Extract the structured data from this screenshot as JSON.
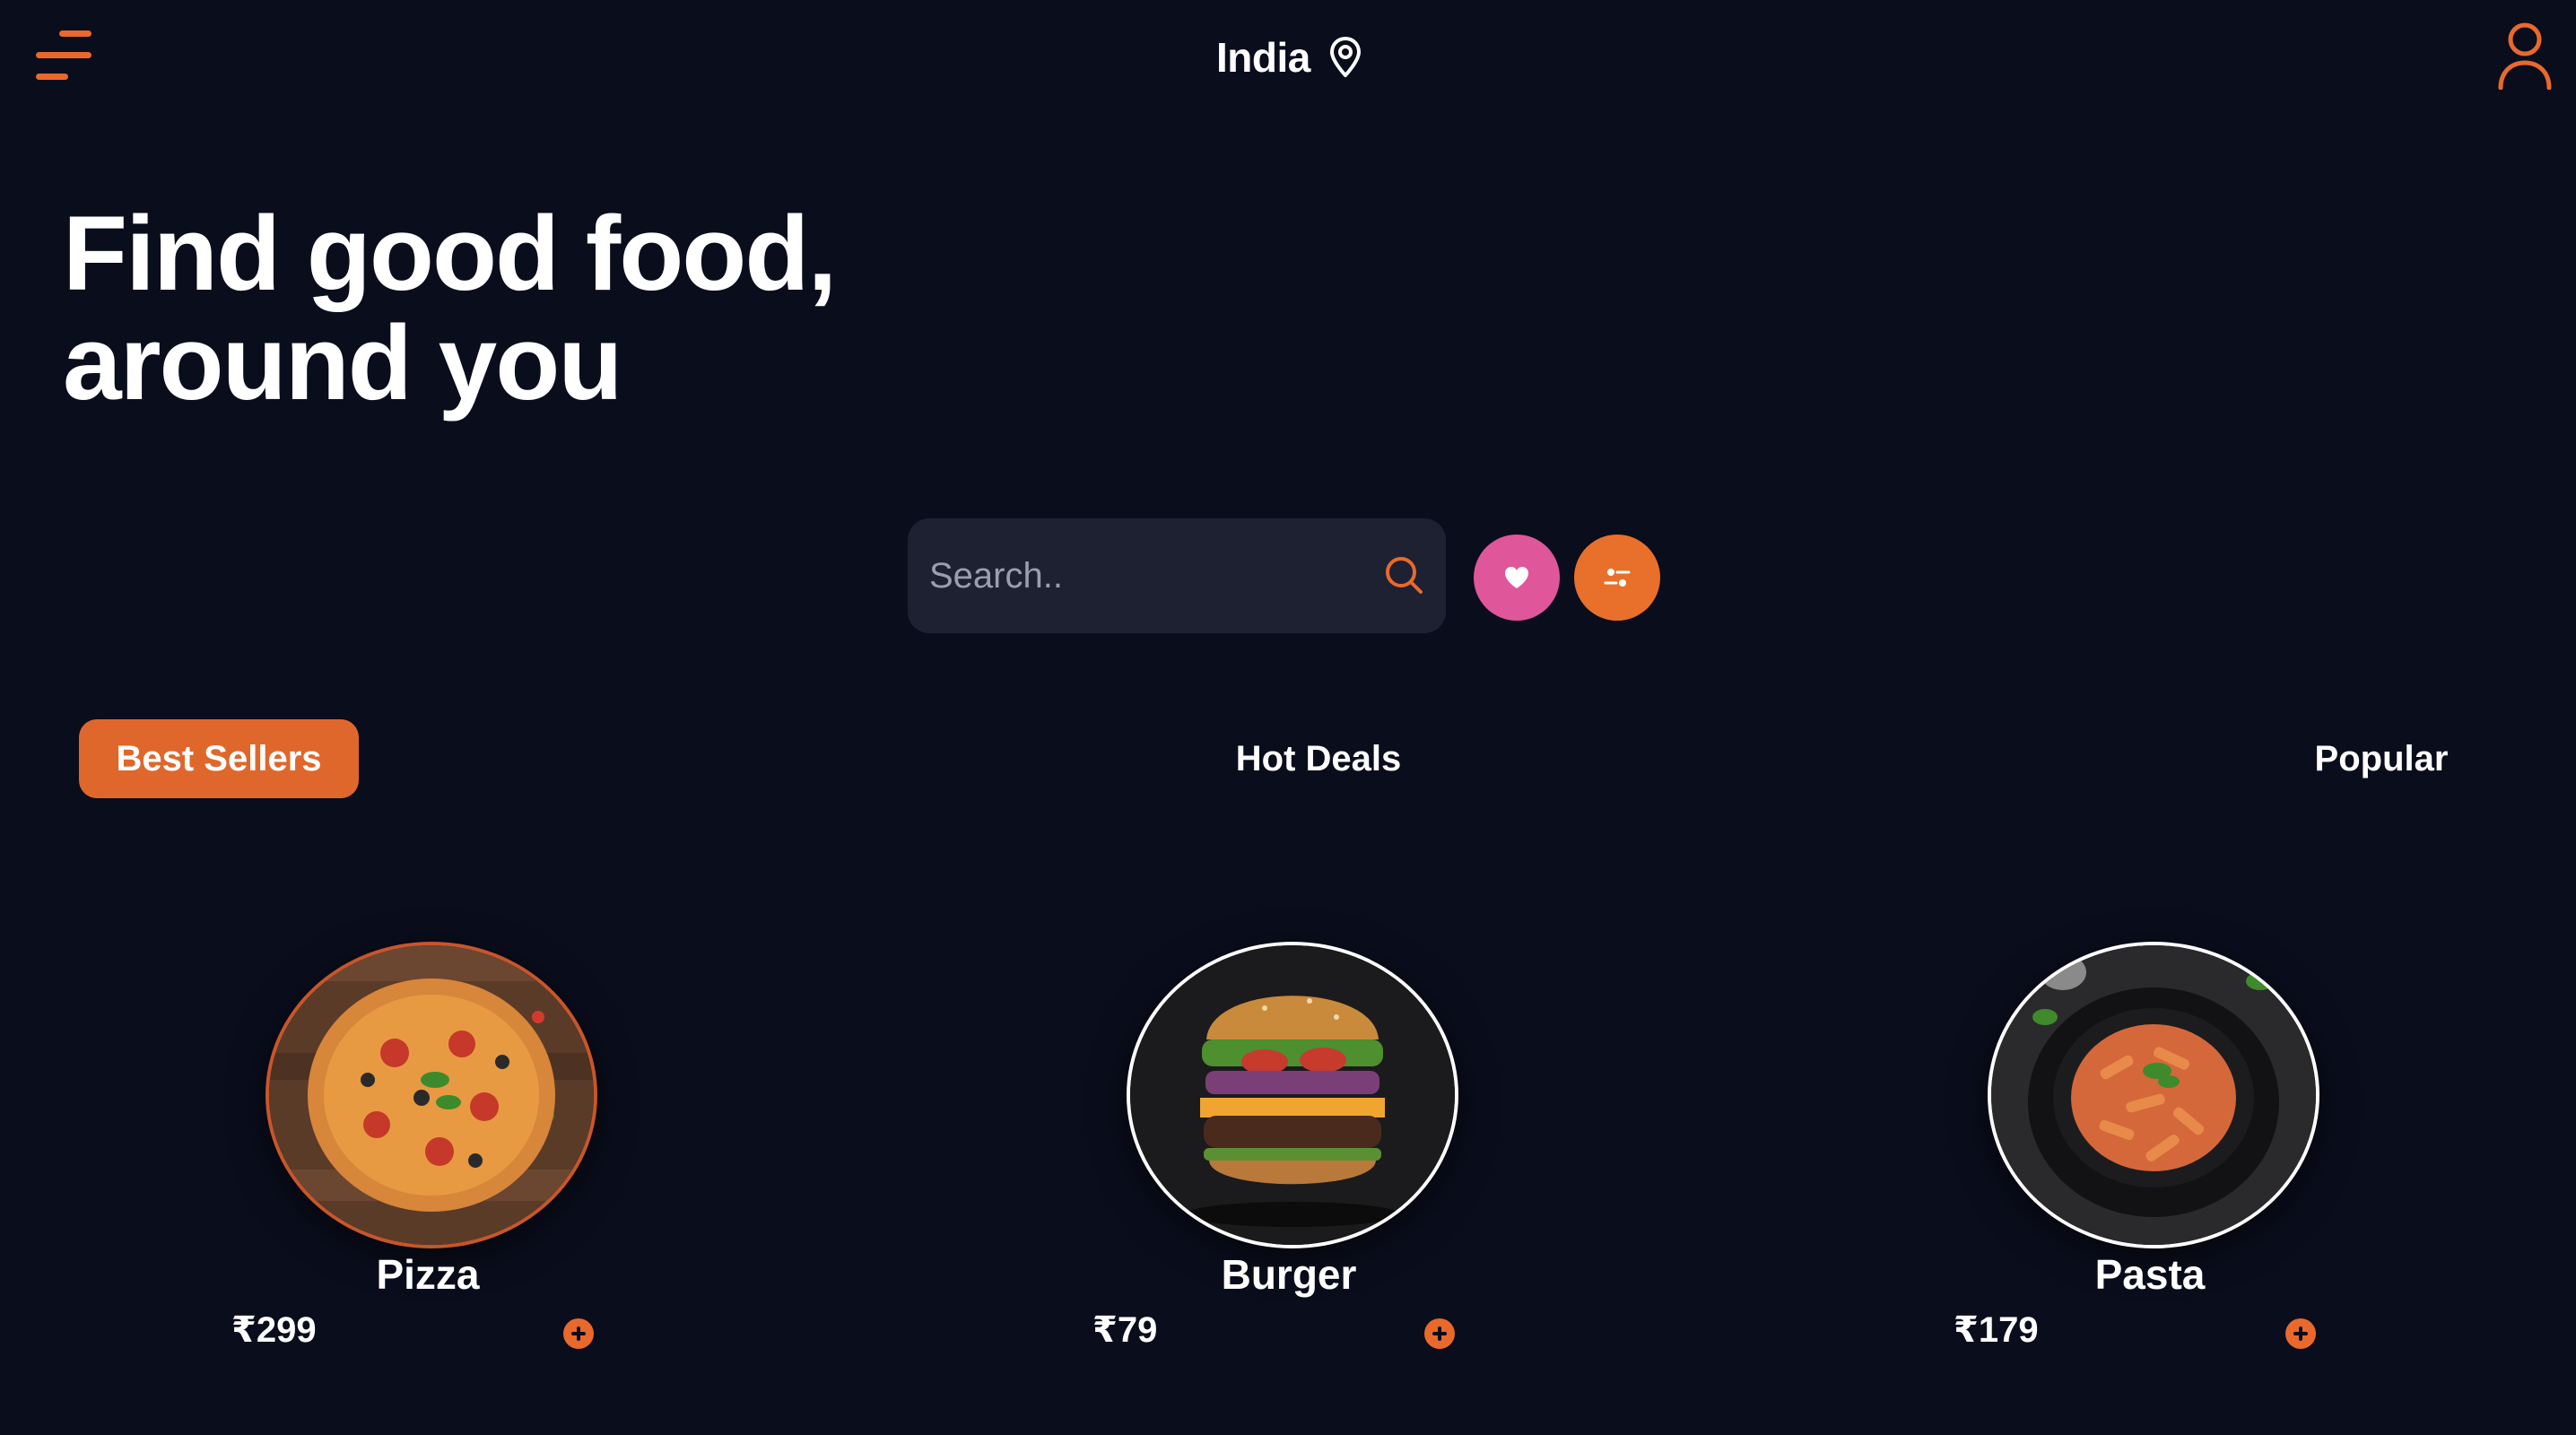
{
  "header": {
    "location": "India",
    "menu_icon": "hamburger-menu-icon",
    "location_icon": "map-pin-icon",
    "user_icon": "user-profile-icon"
  },
  "hero": {
    "title_line1": "Find good food,",
    "title_line2": "around you"
  },
  "search": {
    "placeholder": "Search..",
    "value": "",
    "icon": "search-icon"
  },
  "actions": {
    "favorite_icon": "heart-icon",
    "filter_icon": "sliders-icon"
  },
  "tabs": [
    {
      "label": "Best Sellers",
      "active": true
    },
    {
      "label": "Hot Deals",
      "active": false
    },
    {
      "label": "Popular",
      "active": false
    }
  ],
  "dishes": [
    {
      "name": "Pizza",
      "price": "₹299"
    },
    {
      "name": "Burger",
      "price": "₹79"
    },
    {
      "name": "Pasta",
      "price": "₹179"
    }
  ],
  "colors": {
    "background": "#0a0d1c",
    "accent": "#e9692c",
    "favorite": "#e0569a",
    "search_bg": "#1d2131"
  }
}
